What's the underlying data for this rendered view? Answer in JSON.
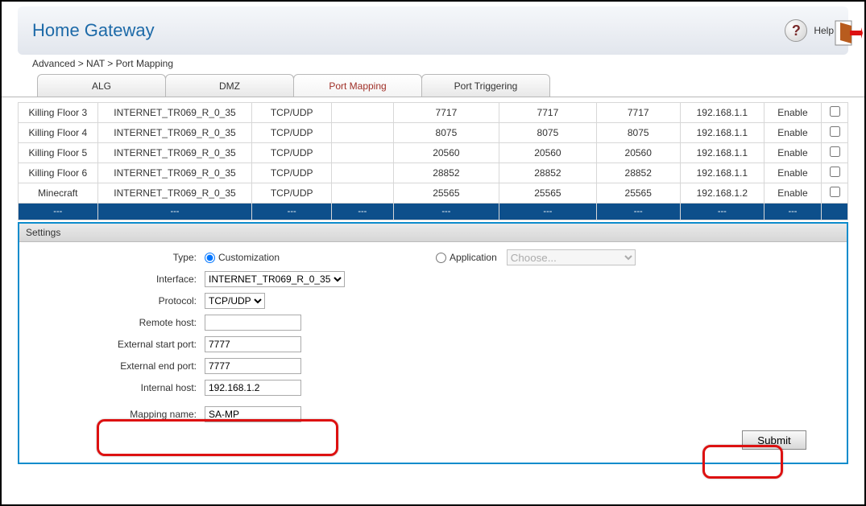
{
  "header": {
    "title": "Home Gateway",
    "help_label": "Help"
  },
  "breadcrumb": "Advanced > NAT > Port Mapping",
  "tabs": [
    {
      "label": "ALG",
      "active": false
    },
    {
      "label": "DMZ",
      "active": false
    },
    {
      "label": "Port Mapping",
      "active": true
    },
    {
      "label": "Port Triggering",
      "active": false
    }
  ],
  "table_rows": [
    {
      "name": "Killing Floor 3",
      "iface": "INTERNET_TR069_R_0_35",
      "proto": "TCP/UDP",
      "ext_start": "7717",
      "ext_end": "7717",
      "int_port": "7717",
      "host": "192.168.1.1",
      "status": "Enable"
    },
    {
      "name": "Killing Floor 4",
      "iface": "INTERNET_TR069_R_0_35",
      "proto": "TCP/UDP",
      "ext_start": "8075",
      "ext_end": "8075",
      "int_port": "8075",
      "host": "192.168.1.1",
      "status": "Enable"
    },
    {
      "name": "Killing Floor 5",
      "iface": "INTERNET_TR069_R_0_35",
      "proto": "TCP/UDP",
      "ext_start": "20560",
      "ext_end": "20560",
      "int_port": "20560",
      "host": "192.168.1.1",
      "status": "Enable"
    },
    {
      "name": "Killing Floor 6",
      "iface": "INTERNET_TR069_R_0_35",
      "proto": "TCP/UDP",
      "ext_start": "28852",
      "ext_end": "28852",
      "int_port": "28852",
      "host": "192.168.1.1",
      "status": "Enable"
    },
    {
      "name": "Minecraft",
      "iface": "INTERNET_TR069_R_0_35",
      "proto": "TCP/UDP",
      "ext_start": "25565",
      "ext_end": "25565",
      "int_port": "25565",
      "host": "192.168.1.2",
      "status": "Enable"
    }
  ],
  "filler_cells": [
    "---",
    "---",
    "---",
    "---",
    "---",
    "---",
    "---",
    "---",
    "---",
    ""
  ],
  "settings": {
    "panel_title": "Settings",
    "labels": {
      "type": "Type:",
      "interface": "Interface:",
      "protocol": "Protocol:",
      "remote_host": "Remote host:",
      "ext_start": "External start port:",
      "ext_end": "External end port:",
      "int_host": "Internal host:",
      "mapping_name": "Mapping name:"
    },
    "type_options": {
      "customization": "Customization",
      "application": "Application"
    },
    "application_placeholder": "Choose...",
    "interface_value": "INTERNET_TR069_R_0_35",
    "protocol_value": "TCP/UDP",
    "remote_host_value": "",
    "ext_start_value": "7777",
    "ext_end_value": "7777",
    "int_host_value": "192.168.1.2",
    "mapping_name_value": "SA-MP",
    "submit_label": "Submit"
  }
}
